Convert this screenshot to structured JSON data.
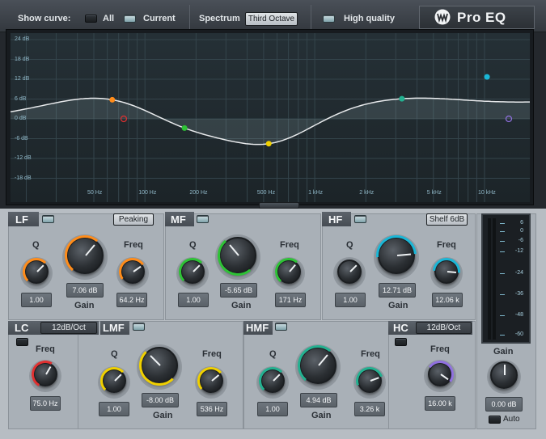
{
  "toolbar": {
    "show_curve_label": "Show curve:",
    "all_label": "All",
    "current_label": "Current",
    "spectrum_label": "Spectrum",
    "spectrum_value": "Third Octave",
    "high_quality_label": "High quality",
    "logo_text": "Pro EQ",
    "all_on": false,
    "current_on": true,
    "high_quality_on": true
  },
  "graph": {
    "db_labels": [
      "24 dB",
      "18 dB",
      "12 dB",
      "6 dB",
      "0 dB",
      "-6 dB",
      "-12 dB",
      "-18 dB"
    ],
    "freq_labels": [
      "50 Hz",
      "100 Hz",
      "200 Hz",
      "500 Hz",
      "1 kHz",
      "2 kHz",
      "5 kHz",
      "10 kHz"
    ],
    "colors": {
      "lf": "#ff8c1a",
      "mf": "#2ec236",
      "lmf": "#f0d000",
      "hf": "#1ab6d6",
      "hmf": "#24b090",
      "lc": "#e03030",
      "hc": "#9070e0",
      "curve": "#e8eaec"
    }
  },
  "bands": {
    "lf": {
      "name": "LF",
      "mode": "Peaking",
      "q_label": "Q",
      "q_value": "1.00",
      "gain_label": "Gain",
      "gain_value": "7.06 dB",
      "freq_label": "Freq",
      "freq_value": "64.2 Hz",
      "enabled": true
    },
    "mf": {
      "name": "MF",
      "q_label": "Q",
      "q_value": "1.00",
      "gain_label": "Gain",
      "gain_value": "-5.65 dB",
      "freq_label": "Freq",
      "freq_value": "171 Hz",
      "enabled": true
    },
    "hf": {
      "name": "HF",
      "mode": "Shelf 6dB",
      "q_label": "Q",
      "q_value": "1.00",
      "gain_label": "Gain",
      "gain_value": "12.71 dB",
      "freq_label": "Freq",
      "freq_value": "12.06 k",
      "enabled": true
    },
    "lc": {
      "name": "LC",
      "slope": "12dB/Oct",
      "freq_label": "Freq",
      "freq_value": "75.0 Hz",
      "enabled": false
    },
    "lmf": {
      "name": "LMF",
      "q_label": "Q",
      "q_value": "1.00",
      "gain_label": "Gain",
      "gain_value": "-8.00 dB",
      "freq_label": "Freq",
      "freq_value": "536 Hz",
      "enabled": true
    },
    "hmf": {
      "name": "HMF",
      "q_label": "Q",
      "q_value": "1.00",
      "gain_label": "Gain",
      "gain_value": "4.94 dB",
      "freq_label": "Freq",
      "freq_value": "3.26 k",
      "enabled": true
    },
    "hc": {
      "name": "HC",
      "slope": "12dB/Oct",
      "freq_label": "Freq",
      "freq_value": "16.00 k",
      "enabled": false
    }
  },
  "output": {
    "meter_ticks": [
      "6",
      "0",
      "-6",
      "-12",
      "-24",
      "-36",
      "-48",
      "-60"
    ],
    "gain_label": "Gain",
    "gain_value": "0.00 dB",
    "auto_label": "Auto",
    "auto_on": false
  }
}
